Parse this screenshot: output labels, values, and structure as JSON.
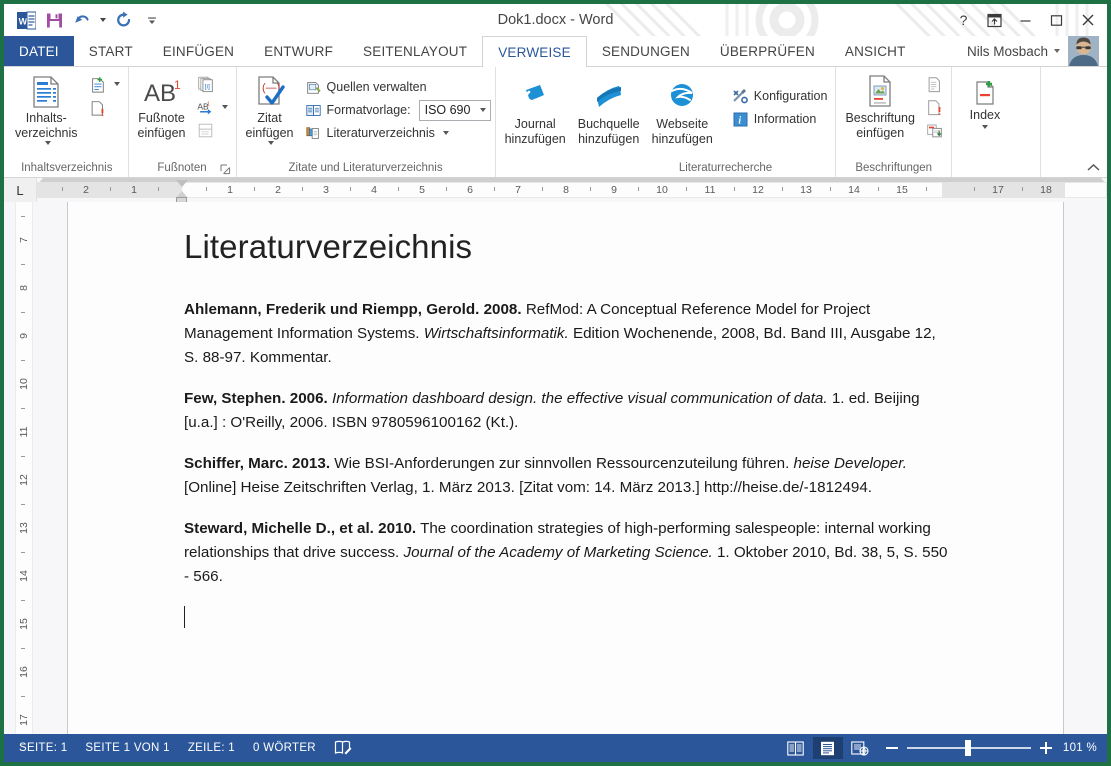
{
  "window": {
    "title": "Dok1.docx - Word",
    "quick_access": [
      {
        "name": "word-logo-icon",
        "label": "W"
      },
      {
        "name": "save-icon",
        "label": "Speichern"
      },
      {
        "name": "undo-icon",
        "label": "Rückgängig"
      },
      {
        "name": "redo-icon",
        "label": "Wiederholen"
      },
      {
        "name": "customize-qat-icon",
        "label": "Symbolleiste für den Schnellzugriff anpassen"
      }
    ],
    "controls": {
      "help": "?",
      "ribbon_display": "Optionen für Menübandanzeige",
      "minimize": "–",
      "maximize": "□",
      "close": "✕"
    }
  },
  "tabs": {
    "file": "DATEI",
    "items": [
      {
        "label": "START",
        "active": false
      },
      {
        "label": "EINFÜGEN",
        "active": false
      },
      {
        "label": "ENTWURF",
        "active": false
      },
      {
        "label": "SEITENLAYOUT",
        "active": false
      },
      {
        "label": "VERWEISE",
        "active": true
      },
      {
        "label": "SENDUNGEN",
        "active": false
      },
      {
        "label": "ÜBERPRÜFEN",
        "active": false
      },
      {
        "label": "ANSICHT",
        "active": false
      }
    ]
  },
  "account": {
    "name": "Nils Mosbach"
  },
  "ribbon": {
    "groups": [
      {
        "name": "inhaltsverzeichnis",
        "label": "Inhaltsverzeichnis",
        "big": {
          "label": "Inhalts-\nverzeichnis",
          "has_caret": true
        },
        "small": [
          {
            "label": "Text hinzufügen",
            "icon": "add-text-icon",
            "has_caret": true
          },
          {
            "label": "Inhaltsverzeichnis aktualisieren",
            "icon": "update-toc-icon",
            "has_caret": false
          }
        ]
      },
      {
        "name": "fussnoten",
        "label": "Fußnoten",
        "big": {
          "label": "Fußnote\neinfügen",
          "has_caret": false
        },
        "small": [
          {
            "label": "Endnote einfügen",
            "icon": "insert-endnote-icon",
            "has_caret": false
          },
          {
            "label": "Nächste Fußnote",
            "icon": "next-footnote-icon",
            "has_caret": true
          },
          {
            "label": "Notizen anzeigen",
            "icon": "show-notes-icon",
            "has_caret": false
          }
        ],
        "has_launcher": true
      },
      {
        "name": "zitate-und-literaturverzeichnis",
        "label": "Zitate und Literaturverzeichnis",
        "big": {
          "label": "Zitat\neinfügen",
          "has_caret": true
        },
        "rows": [
          {
            "label": "Quellen verwalten",
            "icon": "manage-sources-icon",
            "type": "button"
          },
          {
            "label": "Formatvorlage:",
            "icon": "style-icon",
            "type": "combo",
            "value": "ISO 690"
          },
          {
            "label": "Literaturverzeichnis",
            "icon": "bibliography-icon",
            "type": "button",
            "has_caret": true
          }
        ]
      },
      {
        "name": "literaturrecherche",
        "label": "Literaturrecherche",
        "big_buttons": [
          {
            "label": "Journal\nhinzufügen",
            "icon": "journal-icon"
          },
          {
            "label": "Buchquelle\nhinzufügen",
            "icon": "book-icon"
          },
          {
            "label": "Webseite\nhinzufügen",
            "icon": "website-icon"
          }
        ],
        "small": [
          {
            "label": "Konfiguration",
            "icon": "configuration-icon"
          },
          {
            "label": "Information",
            "icon": "information-icon"
          }
        ]
      },
      {
        "name": "beschriftungen",
        "label": "Beschriftungen",
        "big": {
          "label": "Beschriftung\neinfügen",
          "has_caret": false
        },
        "small": [
          {
            "label": "Abbildungsverzeichnis einfügen",
            "icon": "table-of-figures-icon"
          },
          {
            "label": "Verzeichnis aktualisieren",
            "icon": "update-table-icon"
          },
          {
            "label": "Querverweis",
            "icon": "cross-reference-icon"
          }
        ]
      },
      {
        "name": "index",
        "label": "",
        "big": {
          "label": "Index",
          "has_caret": true
        }
      }
    ],
    "collapse_label": "Menüband reduzieren"
  },
  "ruler": {
    "tabstop_marker": "L",
    "horizontal_numbers": [
      "2",
      "1",
      "1",
      "2",
      "3",
      "4",
      "5",
      "6",
      "7",
      "8",
      "9",
      "10",
      "11",
      "12",
      "13",
      "14",
      "15",
      "17",
      "18"
    ],
    "vertical_numbers": [
      "7",
      "8",
      "9",
      "10",
      "11",
      "12",
      "13",
      "14",
      "15",
      "16",
      "17"
    ]
  },
  "document": {
    "title": "Literaturverzeichnis",
    "entries": [
      {
        "id": "ahlemann-riempp-2008",
        "parts": [
          {
            "text": "Ahlemann, Frederik und Riempp, Gerold. 2008.",
            "style": "bold"
          },
          {
            "text": " RefMod: A Conceptual Reference Model for Project Management Information Systems. ",
            "style": "normal"
          },
          {
            "text": "Wirtschaftsinformatik.",
            "style": "italic"
          },
          {
            "text": " Edition Wochenende, 2008, Bd. Band III, Ausgabe 12, S. 88-97. Kommentar.",
            "style": "normal"
          }
        ]
      },
      {
        "id": "few-2006",
        "parts": [
          {
            "text": "Few, Stephen. 2006.",
            "style": "bold"
          },
          {
            "text": " ",
            "style": "normal"
          },
          {
            "text": "Information dashboard design. the effective visual communication of data.",
            "style": "italic"
          },
          {
            "text": " 1. ed. Beijing [u.a.] : O'Reilly, 2006. ISBN 9780596100162 (Kt.).",
            "style": "normal"
          }
        ]
      },
      {
        "id": "schiffer-2013",
        "parts": [
          {
            "text": "Schiffer, Marc. 2013.",
            "style": "bold"
          },
          {
            "text": " Wie BSI-Anforderungen zur sinnvollen Ressourcenzuteilung führen. ",
            "style": "normal"
          },
          {
            "text": "heise Developer.",
            "style": "italic"
          },
          {
            "text": " [Online] Heise Zeitschriften Verlag, 1. März 2013. [Zitat vom: 14. März 2013.] http://heise.de/-1812494.",
            "style": "normal"
          }
        ]
      },
      {
        "id": "steward-2010",
        "parts": [
          {
            "text": "Steward, Michelle D., et al. 2010.",
            "style": "bold"
          },
          {
            "text": " The coordination strategies of high-performing salespeople: internal working relationships that drive success. ",
            "style": "normal"
          },
          {
            "text": "Journal of the Academy of Marketing Science.",
            "style": "italic"
          },
          {
            "text": " 1. Oktober 2010, Bd. 38, 5, S. 550 - 566.",
            "style": "normal"
          }
        ]
      }
    ]
  },
  "statusbar": {
    "page": "SEITE: 1",
    "page_of": "SEITE 1 VON 1",
    "line": "ZEILE: 1",
    "words": "0 WÖRTER",
    "proofing_icon": "proofing-language-icon",
    "views": [
      {
        "name": "read-mode-view",
        "active": false
      },
      {
        "name": "print-layout-view",
        "active": true
      },
      {
        "name": "web-layout-view",
        "active": false
      }
    ],
    "zoom_value": "101 %",
    "zoom_minus": "–",
    "zoom_plus": "+"
  },
  "colors": {
    "word_blue": "#2b579a",
    "window_border_green": "#1e7145",
    "accent_icon_blue": "#1e90d6",
    "statusbar_blue": "#2b579a"
  }
}
